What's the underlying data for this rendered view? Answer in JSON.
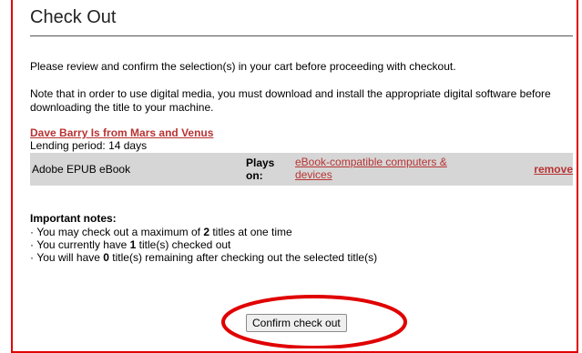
{
  "page": {
    "title": "Check Out",
    "intro": "Please review and confirm the selection(s) in your cart before proceeding with checkout.",
    "note": "Note that in order to use digital media, you must download and install the appropriate digital software before downloading the title to your machine."
  },
  "cart_item": {
    "title": "Dave Barry Is from Mars and Venus",
    "lending_period": "Lending period: 14 days",
    "format": "Adobe EPUB eBook",
    "plays_on_label": "Plays on:",
    "devices_link": "eBook-compatible computers & devices",
    "remove_label": "remove"
  },
  "notes": {
    "heading": "Important notes:",
    "line1_pre": "You may check out a maximum of ",
    "line1_num": "2",
    "line1_post": " titles at one time",
    "line2_pre": "You currently have ",
    "line2_num": "1",
    "line2_post": " title(s) checked out",
    "line3_pre": "You will have ",
    "line3_num": "0",
    "line3_post": " title(s) remaining after checking out the selected title(s)"
  },
  "actions": {
    "confirm_label": "Confirm check out"
  },
  "colors": {
    "link": "#b83333",
    "highlight": "#e00000",
    "format_bar": "#d6d6d6"
  }
}
